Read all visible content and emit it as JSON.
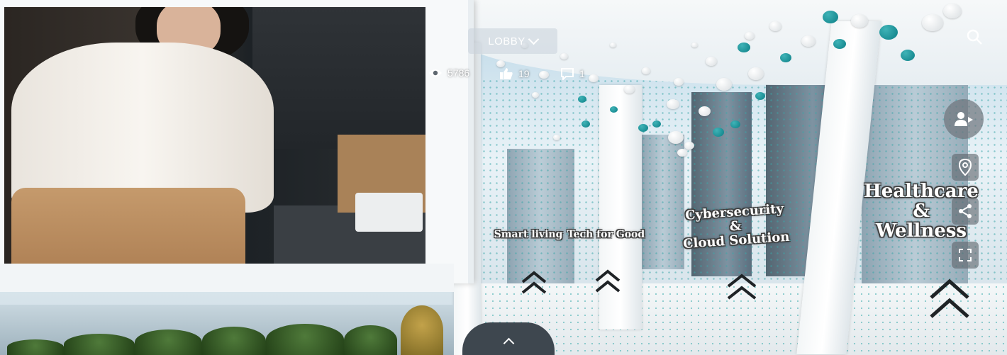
{
  "nav": {
    "lobby_label": "LOBBY"
  },
  "stats": {
    "views": "5786",
    "likes": "19",
    "comments": "1"
  },
  "zones": [
    {
      "label_lines": [
        "Smart living"
      ]
    },
    {
      "label_lines": [
        "Tech for Good"
      ]
    },
    {
      "label_lines": [
        "Cybersecurity",
        "&",
        "Cloud Solution"
      ]
    },
    {
      "label_lines": [
        "Healthcare",
        "&",
        "Wellness"
      ]
    }
  ],
  "icons": {
    "views": "eye-icon",
    "likes": "thumbs-up-icon",
    "comments": "comment-icon",
    "search": "search-icon",
    "presenter": "person-presenter-icon",
    "map": "location-pin-icon",
    "share": "share-icon",
    "fullscreen": "fullscreen-icon",
    "expand": "chevron-up-icon"
  },
  "colors": {
    "accent_teal": "#0c7f86",
    "label_outline": "#3d3d3d",
    "control_bg": "#60666c"
  }
}
